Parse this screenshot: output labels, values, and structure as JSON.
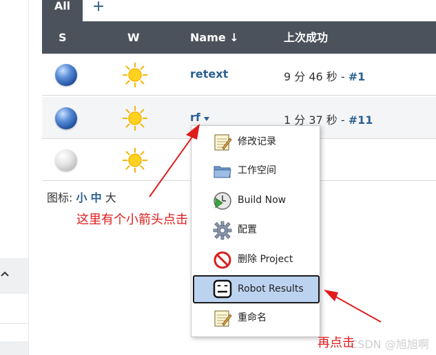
{
  "tabs": {
    "all": "All",
    "add": "+"
  },
  "table": {
    "headers": {
      "s": "S",
      "w": "W",
      "name": "Name ↓",
      "last_success": "上次成功"
    },
    "rows": [
      {
        "name": "retext",
        "last": "9 分 46 秒 - ",
        "build": "#1",
        "status": "blue",
        "weather": "sunny"
      },
      {
        "name": "rf",
        "last": "1 分 37 秒 - ",
        "build": "#11",
        "status": "blue",
        "weather": "sunny"
      },
      {
        "name": "",
        "last": "",
        "build": "",
        "status": "grey",
        "weather": "sunny"
      }
    ]
  },
  "legend": {
    "label": "图标: ",
    "small": "小",
    "medium": "中",
    "large": "大"
  },
  "menu": {
    "items": [
      {
        "label": "修改记录",
        "icon": "notepad-icon"
      },
      {
        "label": "工作空间",
        "icon": "folder-icon"
      },
      {
        "label": "Build Now",
        "icon": "clock-play-icon"
      },
      {
        "label": "配置",
        "icon": "gear-icon"
      },
      {
        "label": "删除 Project",
        "icon": "no-entry-icon"
      },
      {
        "label": "Robot Results",
        "icon": "robot-icon"
      },
      {
        "label": "重命名",
        "icon": "notepad-icon"
      }
    ]
  },
  "annotations": {
    "arrow_hint": "这里有个小箭头点击",
    "click_again": "再点击"
  },
  "watermark": "CSDN @旭旭啊",
  "colors": {
    "header_bg": "#4b525b",
    "link": "#2a6090",
    "selected_bg": "#bcd3f0",
    "annotation": "#e01b1b"
  }
}
